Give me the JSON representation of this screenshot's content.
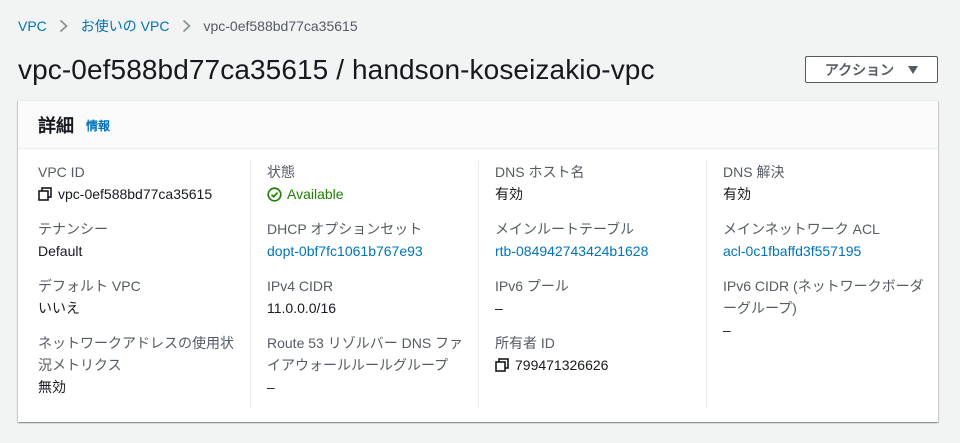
{
  "breadcrumb": {
    "root": "VPC",
    "parent": "お使いの VPC",
    "current": "vpc-0ef588bd77ca35615"
  },
  "header": {
    "title": "vpc-0ef588bd77ca35615 / handson-koseizakio-vpc",
    "action_label": "アクション"
  },
  "details": {
    "title": "詳細",
    "info_label": "情報",
    "columns": [
      [
        {
          "label": "VPC ID",
          "value": "vpc-0ef588bd77ca35615"
        },
        {
          "label": "テナンシー",
          "value": "Default"
        },
        {
          "label": "デフォルト VPC",
          "value": "いいえ"
        },
        {
          "label": "ネットワークアドレスの使用状況メトリクス",
          "value": "無効"
        }
      ],
      [
        {
          "label": "状態",
          "value": "Available"
        },
        {
          "label": "DHCP オプションセット",
          "value": "dopt-0bf7fc1061b767e93"
        },
        {
          "label": "IPv4 CIDR",
          "value": "11.0.0.0/16"
        },
        {
          "label": "Route 53 リゾルバー DNS ファイアウォールルールグループ",
          "value": "–"
        }
      ],
      [
        {
          "label": "DNS ホスト名",
          "value": "有効"
        },
        {
          "label": "メインルートテーブル",
          "value": "rtb-084942743424b1628"
        },
        {
          "label": "IPv6 プール",
          "value": "–"
        },
        {
          "label": "所有者 ID",
          "value": "799471326626"
        }
      ],
      [
        {
          "label": "DNS 解決",
          "value": "有効"
        },
        {
          "label": "メインネットワーク ACL",
          "value": "acl-0c1fbaffd3f557195"
        },
        {
          "label": "IPv6 CIDR (ネットワークボーダーグループ)",
          "value": "–"
        }
      ]
    ]
  },
  "colors": {
    "link": "#0073bb",
    "success": "#1d8102",
    "text": "#16191f",
    "muted": "#545b64",
    "background": "#f2f3f3"
  },
  "icons": {
    "chevron": "chevron-right-icon",
    "copy": "copy-icon",
    "status": "check-circle-icon",
    "caret": "caret-down-icon"
  }
}
